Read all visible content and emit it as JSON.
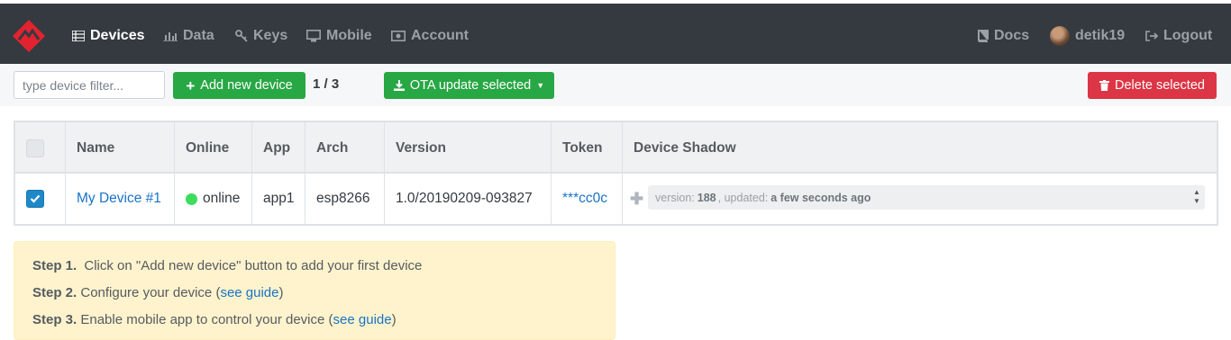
{
  "navbar": {
    "items": [
      {
        "label": "Devices",
        "icon": "list-icon",
        "active": true
      },
      {
        "label": "Data",
        "icon": "bar-chart-icon"
      },
      {
        "label": "Keys",
        "icon": "key-icon"
      },
      {
        "label": "Mobile",
        "icon": "monitor-icon"
      },
      {
        "label": "Account",
        "icon": "money-icon"
      }
    ],
    "right": {
      "docs": "Docs",
      "user": "detik19",
      "logout": "Logout"
    },
    "colors": {
      "bg": "#343a40",
      "logo": "#e0232f"
    }
  },
  "toolbar": {
    "filter_placeholder": "type device filter...",
    "add_label": "Add new device",
    "count": "1 / 3",
    "ota_label": "OTA update selected",
    "delete_label": "Delete selected"
  },
  "table": {
    "headers": [
      "Name",
      "Online",
      "App",
      "Arch",
      "Version",
      "Token",
      "Device Shadow"
    ],
    "rows": [
      {
        "checked": true,
        "name": "My Device #1",
        "online": "online",
        "app": "app1",
        "arch": "esp8266",
        "version": "1.0/20190209-093827",
        "token": "***cc0c",
        "shadow": {
          "version_label": "version:",
          "version_value": "188",
          "updated_label": ", updated:",
          "updated_value": "a few seconds ago"
        }
      }
    ]
  },
  "steps": [
    {
      "label": "Step 1.",
      "text": "Click on \"Add new device\" button to add your first device"
    },
    {
      "label": "Step 2.",
      "text": "Configure your device (",
      "link": "see guide",
      "after": ")"
    },
    {
      "label": "Step 3.",
      "text": "Enable mobile app to control your device (",
      "link": "see guide",
      "after": ")"
    }
  ]
}
